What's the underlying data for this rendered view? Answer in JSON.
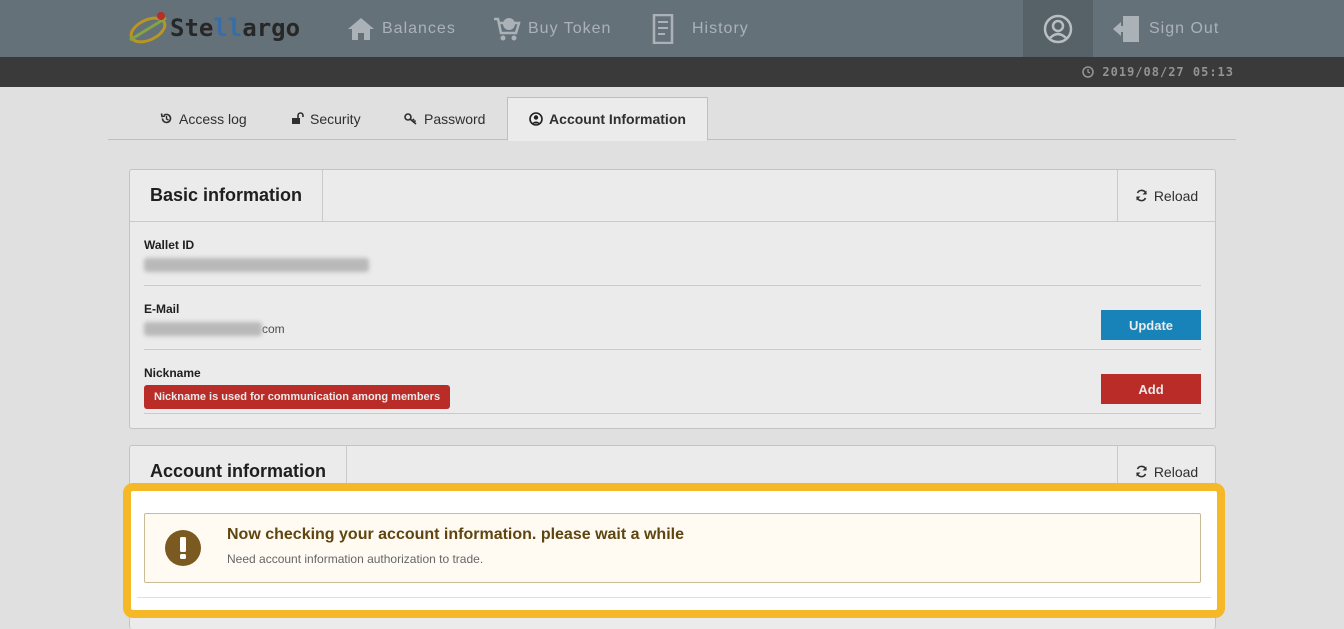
{
  "brand": {
    "logo_prefix": "Ste",
    "logo_highlight": "ll",
    "logo_suffix": "argo"
  },
  "nav": {
    "balances": "Balances",
    "buy_token": "Buy Token",
    "history": "History",
    "sign_out": "Sign Out"
  },
  "clock": {
    "datetime": "2019/08/27 05:13"
  },
  "tabs": [
    {
      "label": "Access log",
      "icon": "history-icon"
    },
    {
      "label": "Security",
      "icon": "unlock-icon"
    },
    {
      "label": "Password",
      "icon": "key-icon"
    },
    {
      "label": "Account Information",
      "icon": "user-circle-icon",
      "active": true
    }
  ],
  "basic": {
    "title": "Basic information",
    "reload": "Reload",
    "wallet_label": "Wallet ID",
    "email_label": "E-Mail",
    "email_suffix": "com",
    "update_label": "Update",
    "nickname_label": "Nickname",
    "nickname_badge": "Nickname is used for communication among members",
    "add_label": "Add"
  },
  "account": {
    "title": "Account information",
    "reload": "Reload"
  },
  "alert": {
    "title": "Now checking your account information. please wait a while",
    "subtitle": "Need account information authorization to trade."
  },
  "colors": {
    "accent": "#1a8fc9",
    "danger": "#c9302c",
    "highlight": "#f5b927",
    "nav_bg": "#6d7b83"
  }
}
